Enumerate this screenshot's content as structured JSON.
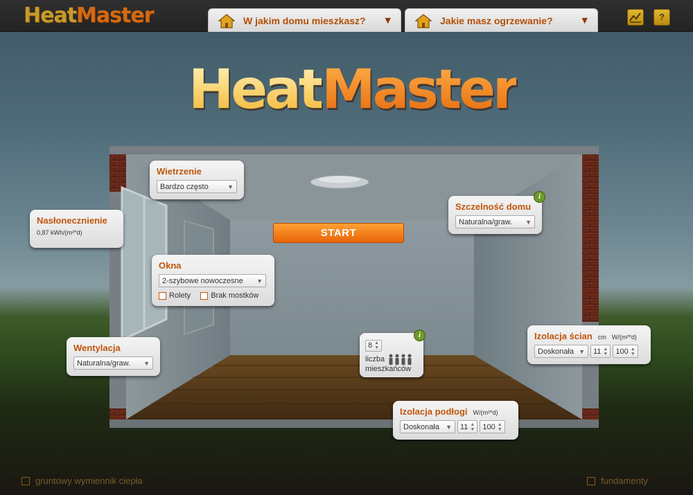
{
  "app": {
    "logo_part1": "Heat",
    "logo_part2": "Master"
  },
  "topbar": {
    "house_type_label": "W jakim domu mieszkasz?",
    "heating_label": "Jakie masz ogrzewanie?",
    "chart_button": "chart-icon",
    "help_button": "?"
  },
  "start_label": "START",
  "wietrzenie": {
    "title": "Wietrzenie",
    "value": "Bardzo często"
  },
  "naslonecznienie": {
    "title": "Nasłonecznienie",
    "value": "0,87 kWh/(m²*d)"
  },
  "okna": {
    "title": "Okna",
    "value": "2-szybowe nowoczesne",
    "rolety": "Rolety",
    "brak_mostkow": "Brak mostków"
  },
  "wentylacja": {
    "title": "Wentylacja",
    "value": "Naturalna/graw."
  },
  "szczelnosc": {
    "title": "Szczelność domu",
    "value": "Naturalna/graw."
  },
  "mieszkancy": {
    "count": "8",
    "label_line1": "liczba",
    "label_line2": "mieszkańców"
  },
  "izolacja_scian": {
    "title": "Izolacja ścian",
    "unit_cm": "cm",
    "unit_w": "W/(m²*d)",
    "value": "Doskonała",
    "thickness": "11",
    "coef": "100"
  },
  "izolacja_podlogi": {
    "title": "Izolacja podłogi",
    "unit_w": "W/(m²*d)",
    "value": "Doskonała",
    "thickness": "11",
    "coef": "100"
  },
  "bottom": {
    "ground_exchanger": "gruntowy wymiennik ciepła",
    "foundations": "fundamenty"
  }
}
